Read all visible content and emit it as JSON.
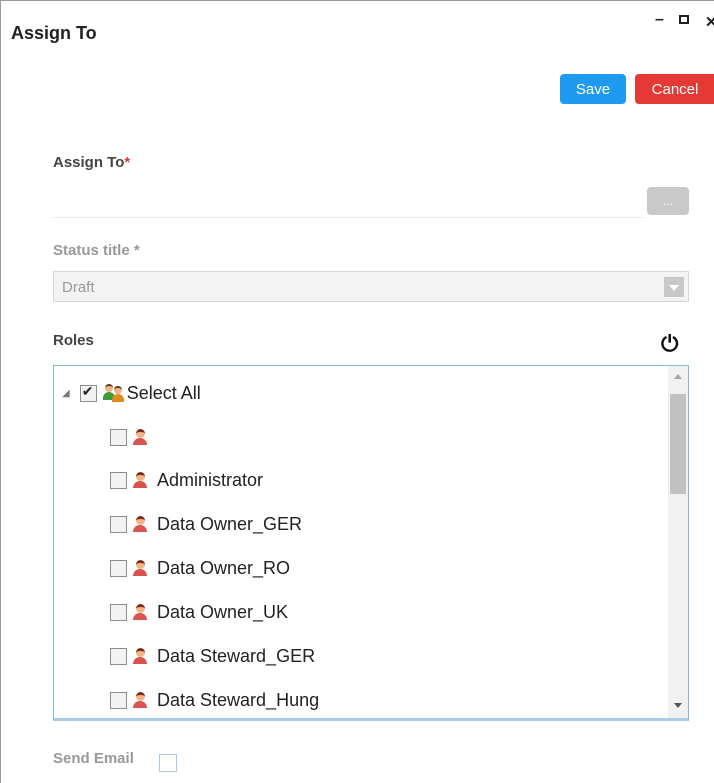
{
  "window": {
    "title": "Assign To",
    "minimize_glyph": "–",
    "close_glyph": "✕"
  },
  "toolbar": {
    "save_label": "Save",
    "cancel_label": "Cancel"
  },
  "assign_to": {
    "label": "Assign To",
    "required_mark": "*",
    "value": "",
    "browse_label": "..."
  },
  "status": {
    "label": "Status title",
    "required_mark": "*",
    "selected": "Draft"
  },
  "roles": {
    "label": "Roles",
    "select_all_label": "Select All",
    "items": [
      {
        "label": "",
        "checked": false
      },
      {
        "label": "Administrator",
        "checked": false
      },
      {
        "label": "Data Owner_GER",
        "checked": false
      },
      {
        "label": "Data Owner_RO",
        "checked": false
      },
      {
        "label": "Data Owner_UK",
        "checked": false
      },
      {
        "label": "Data Steward_GER",
        "checked": false
      },
      {
        "label": "Data Steward_Hung",
        "checked": false
      }
    ]
  },
  "send_email": {
    "label": "Send Email",
    "checked": false
  },
  "icons": {
    "power": "power-icon",
    "user": "user-icon",
    "group": "users-group-icon"
  },
  "colors": {
    "save": "#1e9bf0",
    "cancel": "#e53935",
    "required": "#e53935"
  }
}
